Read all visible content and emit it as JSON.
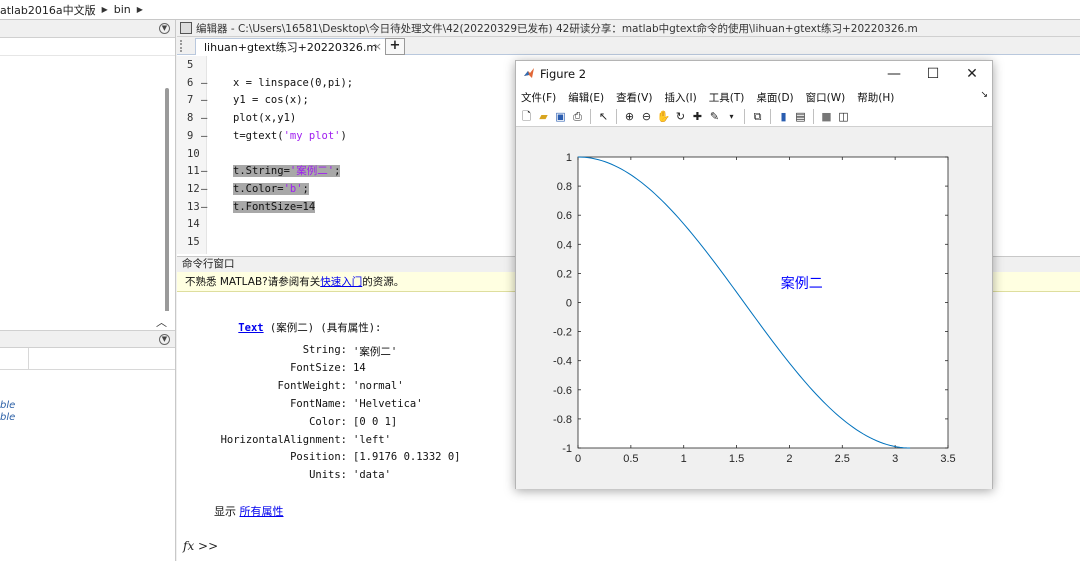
{
  "address_bar": {
    "crumbs": [
      "atlab2016a中文版",
      "bin"
    ]
  },
  "left_panel": {
    "workspace_items": [
      "ble",
      "ble"
    ]
  },
  "editor": {
    "title": "编辑器 - C:\\Users\\16581\\Desktop\\今日待处理文件\\42(20220329已发布) 42研读分享：matlab中gtext命令的使用\\lihuan+gtext练习+20220326.m",
    "tab_label": "lihuan+gtext练习+20220326.m",
    "tab_close": "×",
    "new_tab": "+",
    "lines": [
      {
        "n": "5",
        "dash": "",
        "code": ""
      },
      {
        "n": "6",
        "dash": "—",
        "code": "x = linspace(0,pi);"
      },
      {
        "n": "7",
        "dash": "—",
        "code": "y1 = cos(x);"
      },
      {
        "n": "8",
        "dash": "—",
        "code": "plot(x,y1)"
      },
      {
        "n": "9",
        "dash": "—",
        "code_pre": "t=gtext(",
        "code_str": "'my plot'",
        "code_post": ")"
      },
      {
        "n": "10",
        "dash": "",
        "code": ""
      },
      {
        "n": "11",
        "dash": "—",
        "code_pre": "t.String=",
        "code_str": "'案例二'",
        "code_post": ";",
        "selected": true
      },
      {
        "n": "12",
        "dash": "—",
        "code_pre": "t.Color=",
        "code_str": "'b'",
        "code_post": ";",
        "selected": true
      },
      {
        "n": "13",
        "dash": "—",
        "code": "t.FontSize=14",
        "selected": true
      },
      {
        "n": "14",
        "dash": "",
        "code": ""
      },
      {
        "n": "15",
        "dash": "",
        "code": ""
      }
    ]
  },
  "command_window": {
    "header": "命令行窗口",
    "notice_pre": "不熟悉 MATLAB?请参阅有关",
    "notice_link": "快速入门",
    "notice_post": "的资源。",
    "text_link": "Text",
    "text_desc": " (案例二) (具有属性):",
    "properties": [
      {
        "k": "String:",
        "v": "'案例二'"
      },
      {
        "k": "FontSize:",
        "v": "14"
      },
      {
        "k": "FontWeight:",
        "v": "'normal'"
      },
      {
        "k": "FontName:",
        "v": "'Helvetica'"
      },
      {
        "k": "Color:",
        "v": "[0 0 1]"
      },
      {
        "k": "HorizontalAlignment:",
        "v": "'left'"
      },
      {
        "k": "Position:",
        "v": "[1.9176 0.1332 0]"
      },
      {
        "k": "Units:",
        "v": "'data'"
      }
    ],
    "show_pre": "显示 ",
    "show_link": "所有属性",
    "prompt": "fx >>"
  },
  "figure": {
    "title": "Figure 2",
    "minimize": "—",
    "maximize": "☐",
    "close": "✕",
    "menus": [
      "文件(F)",
      "编辑(E)",
      "查看(V)",
      "插入(I)",
      "工具(T)",
      "桌面(D)",
      "窗口(W)",
      "帮助(H)"
    ],
    "menu_more": "↘",
    "annotation_text": "案例二",
    "annotation_color": "#0000ff",
    "curve_color": "#0072bd"
  },
  "chart_data": {
    "type": "line",
    "series": [
      {
        "function": "cos(x)",
        "x_range": [
          0,
          3.1416
        ],
        "points": 100
      }
    ],
    "xlim": [
      0,
      3.5
    ],
    "ylim": [
      -1,
      1
    ],
    "xticks": [
      "0",
      "0.5",
      "1",
      "1.5",
      "2",
      "2.5",
      "3",
      "3.5"
    ],
    "yticks": [
      "1",
      "0.8",
      "0.6",
      "0.4",
      "0.2",
      "0",
      "-0.2",
      "-0.4",
      "-0.6",
      "-0.8",
      "-1"
    ],
    "annotation": {
      "text": "案例二",
      "x": 1.9176,
      "y": 0.1332
    },
    "grid": false
  }
}
